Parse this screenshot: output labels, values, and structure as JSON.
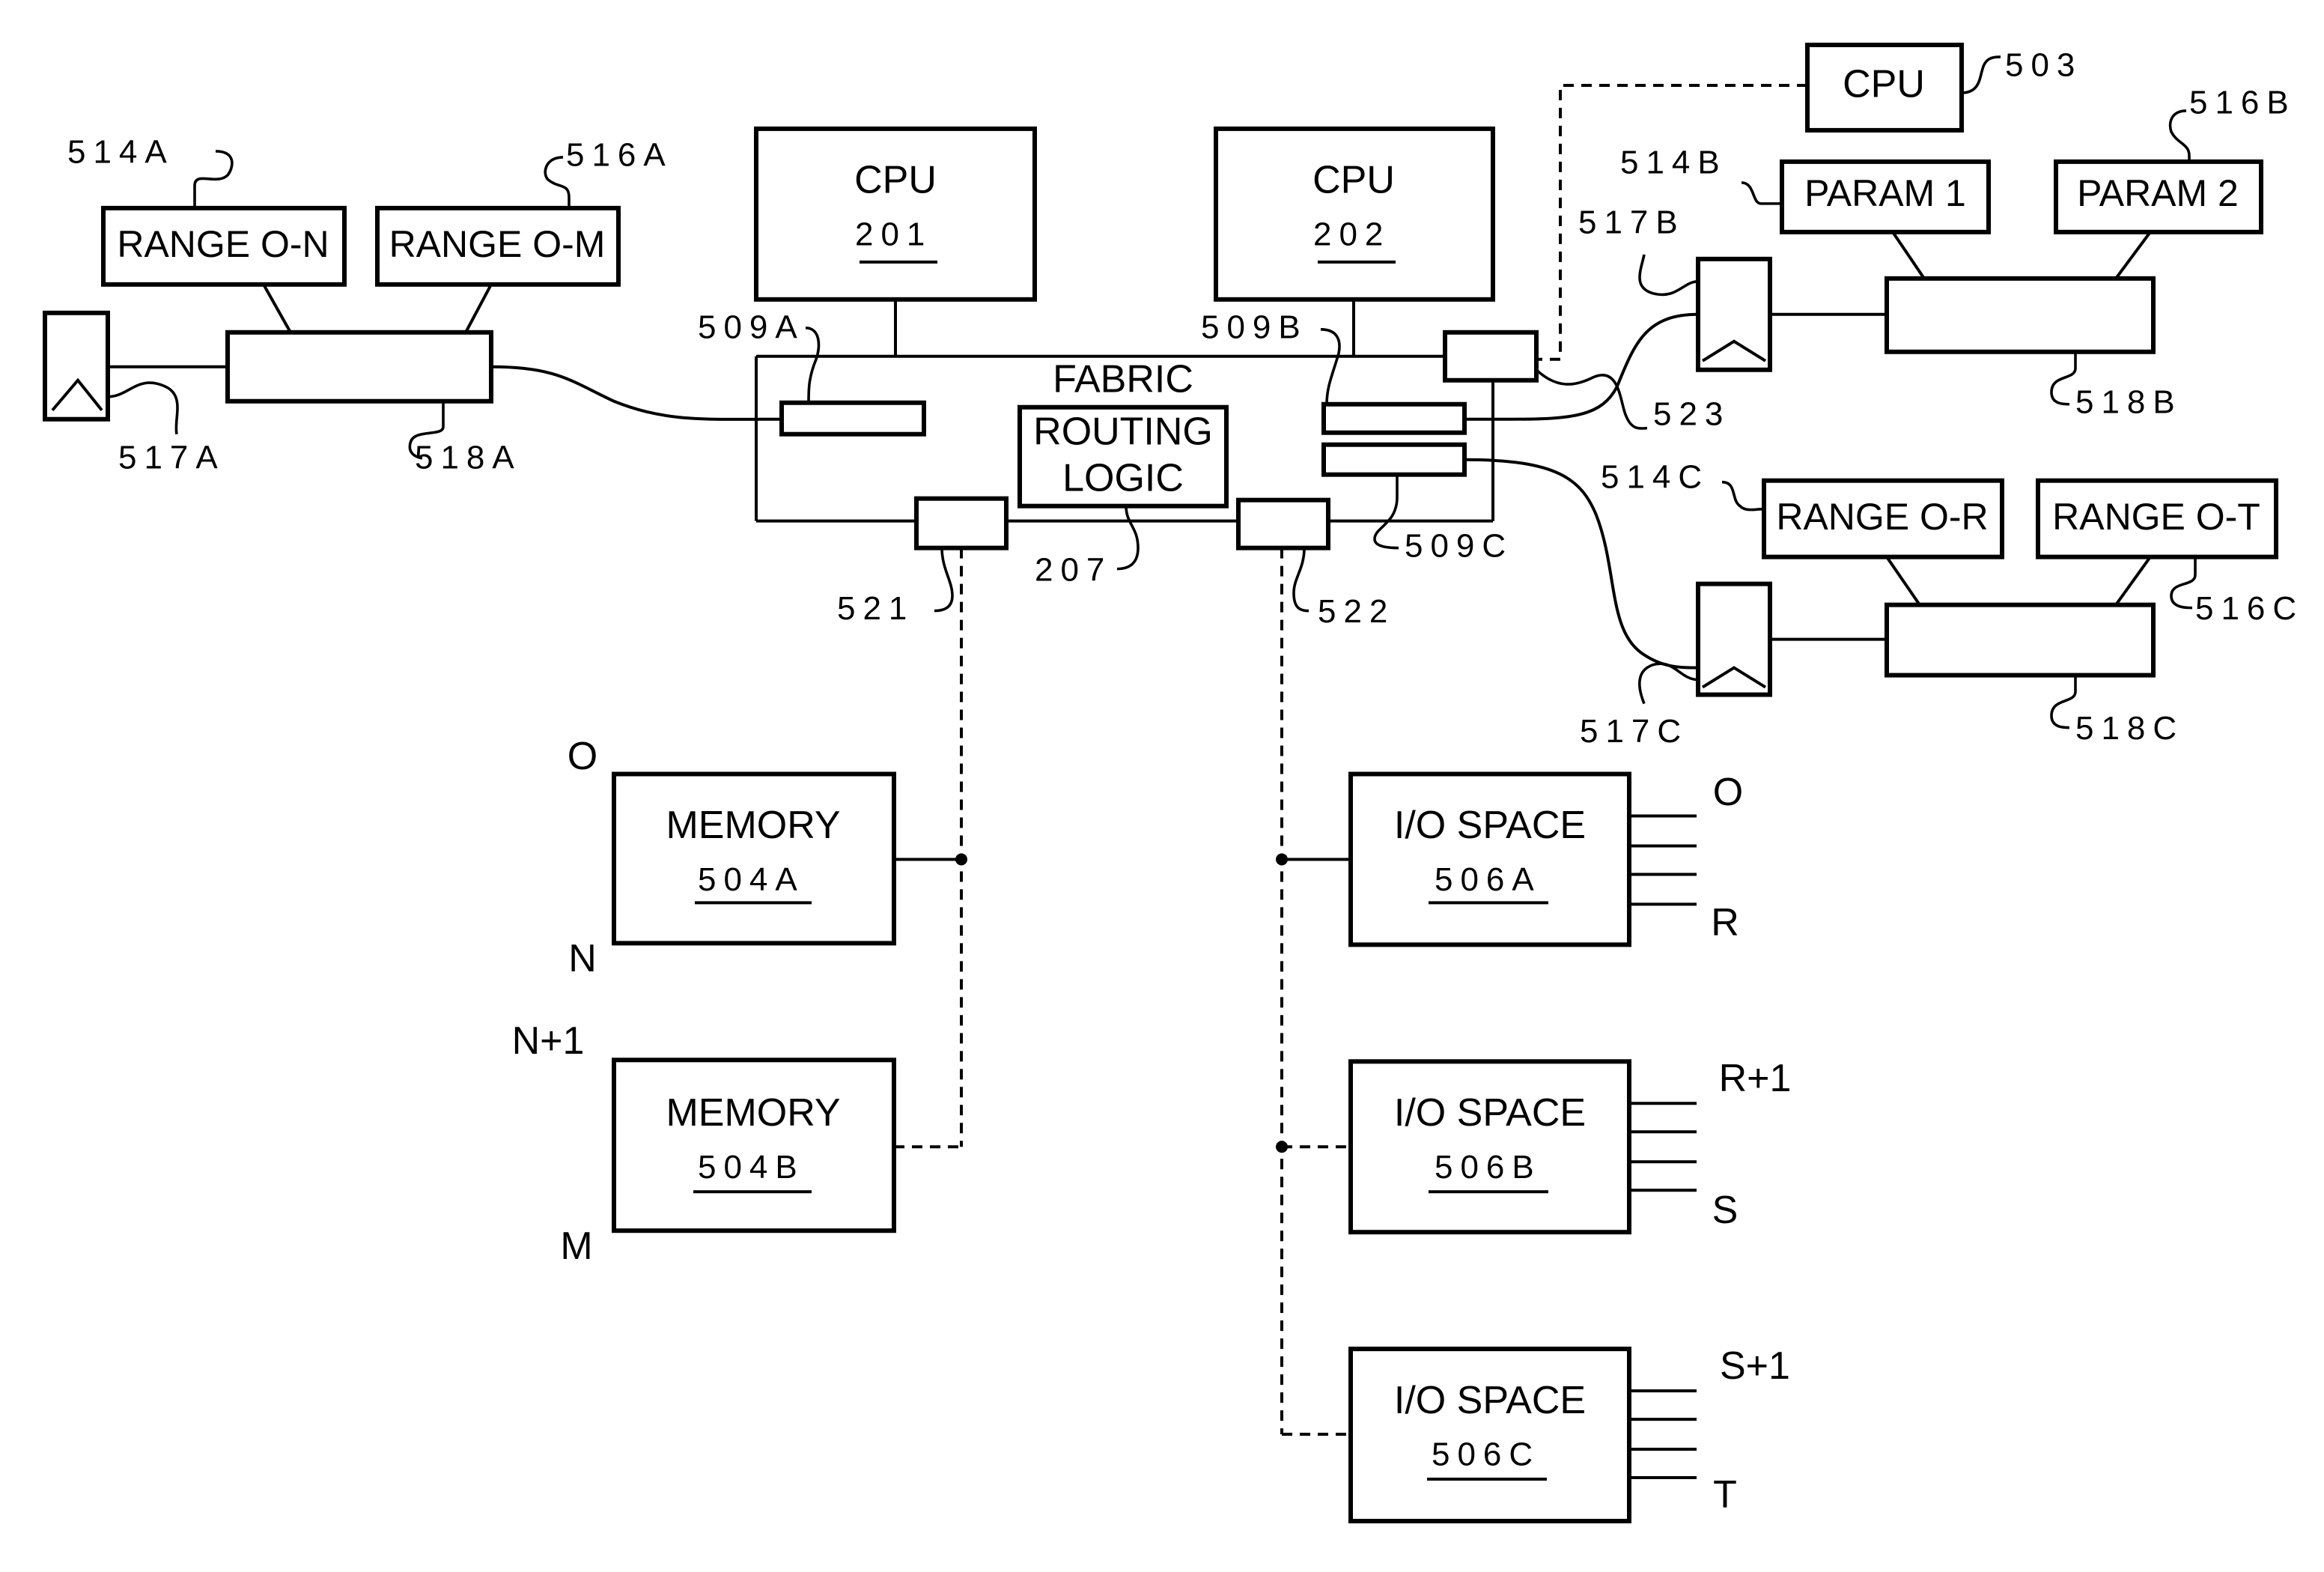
{
  "diagram": {
    "cpus": [
      {
        "id": "cpu-201",
        "title": "CPU",
        "ref": "201"
      },
      {
        "id": "cpu-202",
        "title": "CPU",
        "ref": "202"
      }
    ],
    "external_cpu": {
      "title": "CPU",
      "ref": "503"
    },
    "fabric": {
      "title": "FABRIC",
      "routing_line1": "ROUTING",
      "routing_line2": "LOGIC",
      "routing_ref": "207"
    },
    "fabric_ports": {
      "p509a": "509A",
      "p509b": "509B",
      "p509c": "509C",
      "p521": "521",
      "p522": "522",
      "p523": "523"
    },
    "group_a": {
      "param1": "RANGE O-N",
      "param2": "RANGE O-M",
      "ref_param1": "514A",
      "ref_param2": "516A",
      "ref_device": "517A",
      "ref_table": "518A"
    },
    "group_b": {
      "param1": "PARAM 1",
      "param2": "PARAM 2",
      "ref_param1": "514B",
      "ref_param2": "516B",
      "ref_device": "517B",
      "ref_table": "518B"
    },
    "group_c": {
      "param1": "RANGE O-R",
      "param2": "RANGE O-T",
      "ref_param1": "514C",
      "ref_param2": "516C",
      "ref_device": "517C",
      "ref_table": "518C"
    },
    "memory": [
      {
        "title": "MEMORY",
        "ref": "504A",
        "range_start": "O",
        "range_end": "N"
      },
      {
        "title": "MEMORY",
        "ref": "504B",
        "range_start": "N+1",
        "range_end": "M"
      }
    ],
    "io_spaces": [
      {
        "title": "I/O SPACE",
        "ref": "506A",
        "range_start": "O",
        "range_end": "R"
      },
      {
        "title": "I/O SPACE",
        "ref": "506B",
        "range_start": "R+1",
        "range_end": "S"
      },
      {
        "title": "I/O SPACE",
        "ref": "506C",
        "range_start": "S+1",
        "range_end": "T"
      }
    ]
  }
}
